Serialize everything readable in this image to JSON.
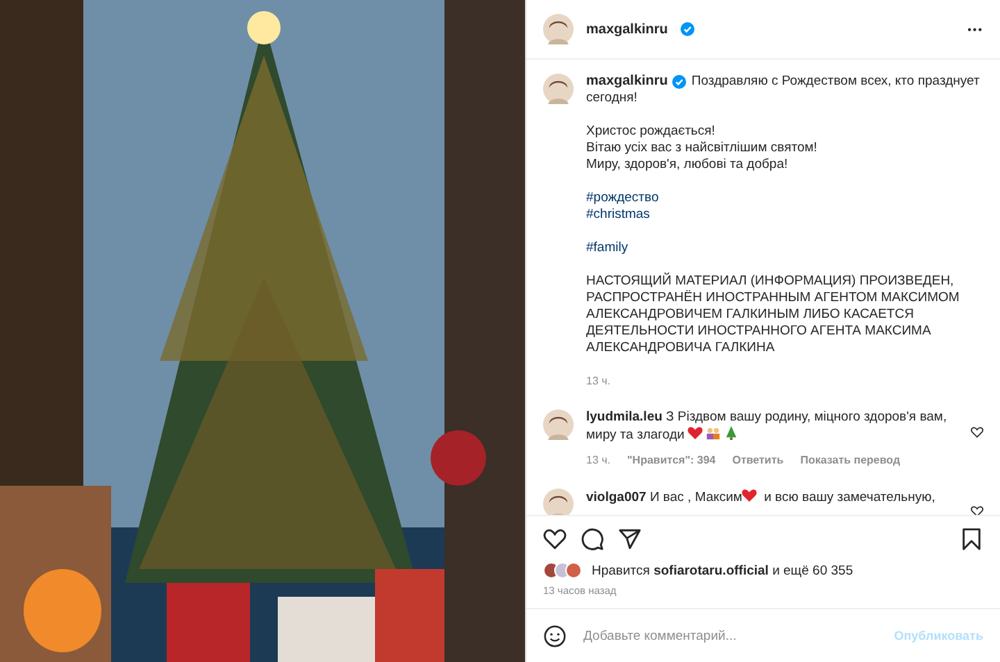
{
  "header": {
    "username": "maxgalkinru",
    "verified": true,
    "more": "•••"
  },
  "caption": {
    "username": "maxgalkinru",
    "verified": true,
    "paragraphs": [
      "Поздравляю с Рождеством всех, кто празднует сегодня!",
      "Христос рождається!\nВітаю усіх вас з найсвітлішим святом!\nМиру, здоров'я, любові та добра!"
    ],
    "hashtags": [
      [
        "#рождество",
        "#christmas"
      ],
      [
        "#family"
      ]
    ],
    "notice": "НАСТОЯЩИЙ МАТЕРИАЛ (ИНФОРМАЦИЯ) ПРОИЗВЕДЕН, РАСПРОСТРАНЁН ИНОСТРАННЫМ АГЕНТОМ МАКСИМОМ АЛЕКСАНДРОВИЧЕМ ГАЛКИНЫМ ЛИБО КАСАЕТСЯ ДЕЯТЕЛЬНОСТИ ИНОСТРАННОГО АГЕНТА МАКСИМА АЛЕКСАНДРОВИЧА ГАЛКИНА",
    "time": "13 ч."
  },
  "comments": [
    {
      "username": "lyudmila.leu",
      "parts": [
        {
          "kind": "text",
          "text": "З Різдвом вашу родину, міцного здоров'я вам, миру та злагоди "
        },
        {
          "kind": "heart"
        },
        {
          "kind": "couple"
        },
        {
          "kind": "tree"
        }
      ],
      "time": "13 ч.",
      "likes": "\"Нравится\": 394",
      "reply": "Ответить",
      "translate": "Показать перевод"
    },
    {
      "username": "violga007",
      "parts": [
        {
          "kind": "text",
          "text": "И вас , Максим"
        },
        {
          "kind": "heart"
        },
        {
          "kind": "text",
          "text": " и всю вашу замечательную,"
        }
      ]
    }
  ],
  "likes": {
    "prefix": "Нравится",
    "user": "sofiarotaru.official",
    "suffix": "и ещё 60 355"
  },
  "time_ago": "13 часов назад",
  "comment_field": {
    "placeholder": "Добавьте комментарий...",
    "publish": "Опубликовать"
  }
}
